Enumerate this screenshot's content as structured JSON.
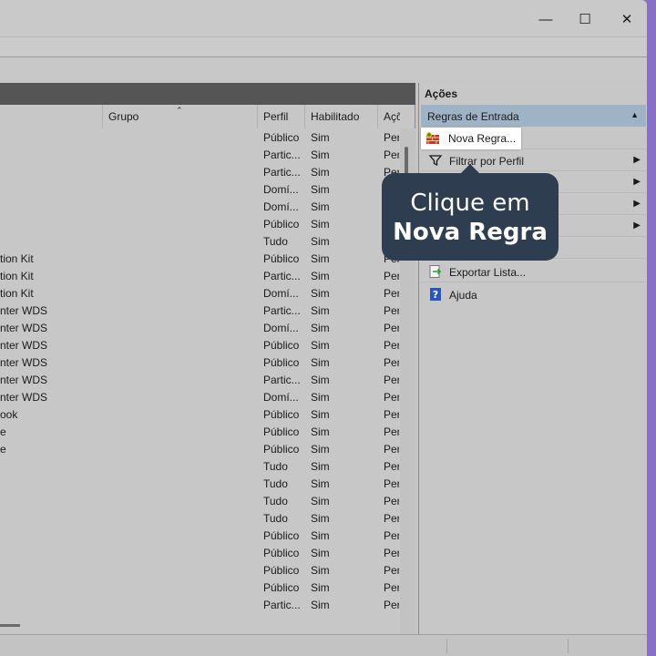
{
  "window": {
    "minimize_glyph": "—",
    "maximize_glyph": "☐",
    "close_glyph": "✕"
  },
  "columns": [
    "Grupo",
    "Perfil",
    "Habilitado",
    "Açõ"
  ],
  "rows": [
    {
      "name": "",
      "profile": "Público",
      "enabled": "Sim",
      "action": "Per"
    },
    {
      "name": "",
      "profile": "Partic...",
      "enabled": "Sim",
      "action": "Per"
    },
    {
      "name": "",
      "profile": "Partic...",
      "enabled": "Sim",
      "action": "Per"
    },
    {
      "name": "",
      "profile": "Domí...",
      "enabled": "Sim",
      "action": "Per"
    },
    {
      "name": "",
      "profile": "Domí...",
      "enabled": "Sim",
      "action": "Per"
    },
    {
      "name": "",
      "profile": "Público",
      "enabled": "Sim",
      "action": "Per"
    },
    {
      "name": "",
      "profile": "Tudo",
      "enabled": "Sim",
      "action": "Per"
    },
    {
      "name": "tion Kit",
      "profile": "Público",
      "enabled": "Sim",
      "action": "Per"
    },
    {
      "name": "tion Kit",
      "profile": "Partic...",
      "enabled": "Sim",
      "action": "Per"
    },
    {
      "name": "tion Kit",
      "profile": "Domí...",
      "enabled": "Sim",
      "action": "Per"
    },
    {
      "name": "nter WDS",
      "profile": "Partic...",
      "enabled": "Sim",
      "action": "Per"
    },
    {
      "name": "nter WDS",
      "profile": "Domí...",
      "enabled": "Sim",
      "action": "Per"
    },
    {
      "name": "nter WDS",
      "profile": "Público",
      "enabled": "Sim",
      "action": "Per"
    },
    {
      "name": "nter WDS",
      "profile": "Público",
      "enabled": "Sim",
      "action": "Per"
    },
    {
      "name": "nter WDS",
      "profile": "Partic...",
      "enabled": "Sim",
      "action": "Per"
    },
    {
      "name": "nter WDS",
      "profile": "Domí...",
      "enabled": "Sim",
      "action": "Per"
    },
    {
      "name": "ook",
      "profile": "Público",
      "enabled": "Sim",
      "action": "Per"
    },
    {
      "name": "e",
      "profile": "Público",
      "enabled": "Sim",
      "action": "Per"
    },
    {
      "name": "e",
      "profile": "Público",
      "enabled": "Sim",
      "action": "Per"
    },
    {
      "name": "",
      "profile": "Tudo",
      "enabled": "Sim",
      "action": "Per"
    },
    {
      "name": "",
      "profile": "Tudo",
      "enabled": "Sim",
      "action": "Per"
    },
    {
      "name": "",
      "profile": "Tudo",
      "enabled": "Sim",
      "action": "Per"
    },
    {
      "name": "",
      "profile": "Tudo",
      "enabled": "Sim",
      "action": "Per"
    },
    {
      "name": "",
      "profile": "Público",
      "enabled": "Sim",
      "action": "Per"
    },
    {
      "name": "",
      "profile": "Público",
      "enabled": "Sim",
      "action": "Per"
    },
    {
      "name": "",
      "profile": "Público",
      "enabled": "Sim",
      "action": "Per"
    },
    {
      "name": "",
      "profile": "Público",
      "enabled": "Sim",
      "action": "Per"
    },
    {
      "name": "",
      "profile": "Partic...",
      "enabled": "Sim",
      "action": "Per"
    }
  ],
  "actions": {
    "title": "Ações",
    "section": "Regras de Entrada",
    "items": [
      {
        "label": "Nova Regra...",
        "icon": "new-rule-icon"
      },
      {
        "label": "Filtrar por Perfil",
        "icon": "filter-icon"
      },
      {
        "label": "",
        "icon": ""
      },
      {
        "label": "",
        "icon": ""
      },
      {
        "label": "",
        "icon": ""
      },
      {
        "label": "",
        "icon": ""
      },
      {
        "label": "Exportar Lista...",
        "icon": "export-icon"
      },
      {
        "label": "Ajuda",
        "icon": "help-icon"
      }
    ]
  },
  "callout": {
    "line1": "Clique em",
    "line2": "Nova Regra"
  },
  "colors": {
    "section_header": "#9fb3c6",
    "callout_bg": "#2e3e50",
    "desktop_bg": "#8a6fc8"
  }
}
